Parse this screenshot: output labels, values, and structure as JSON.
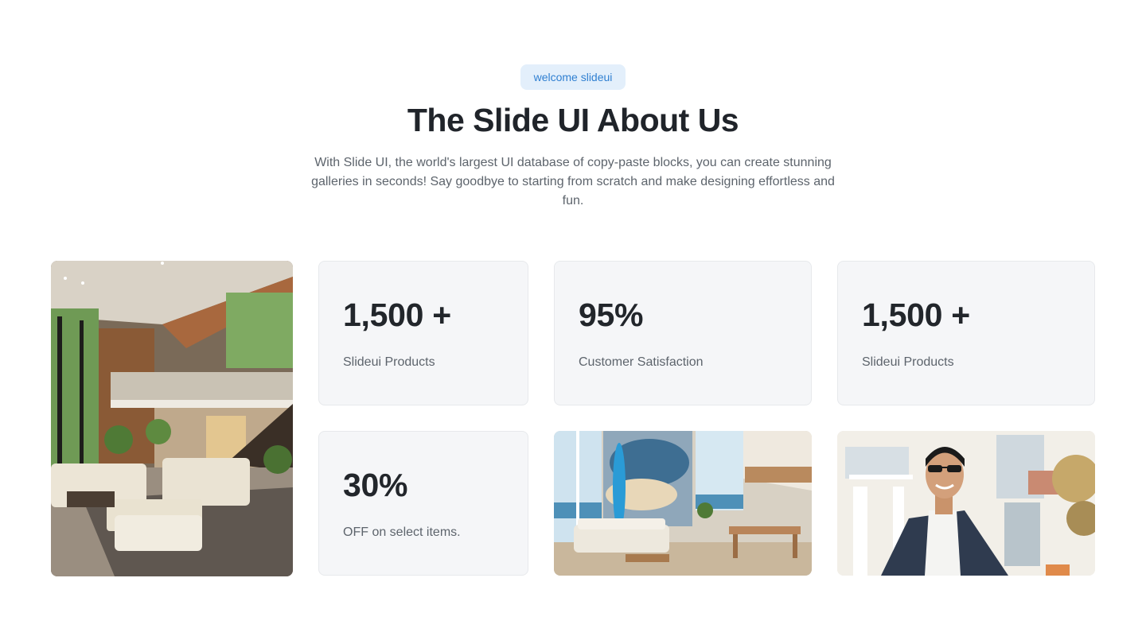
{
  "hero": {
    "badge": "welcome slideui",
    "title": "The Slide UI About Us",
    "description": "With Slide UI, the world's largest UI database of copy-paste blocks, you can create stunning galleries in seconds! Say goodbye to starting from scratch and make designing effortless and fun."
  },
  "stats": [
    {
      "value": "1,500 +",
      "label": "Slideui Products"
    },
    {
      "value": "95%",
      "label": "Customer Satisfaction"
    },
    {
      "value": "1,500 +",
      "label": "Slideui Products"
    },
    {
      "value": "30%",
      "label": "OFF on select items."
    }
  ],
  "colors": {
    "badge_bg": "#e3effb",
    "badge_text": "#2f7fd1",
    "card_bg": "#f5f6f8",
    "heading": "#20242a",
    "body_text": "#5d646c"
  }
}
